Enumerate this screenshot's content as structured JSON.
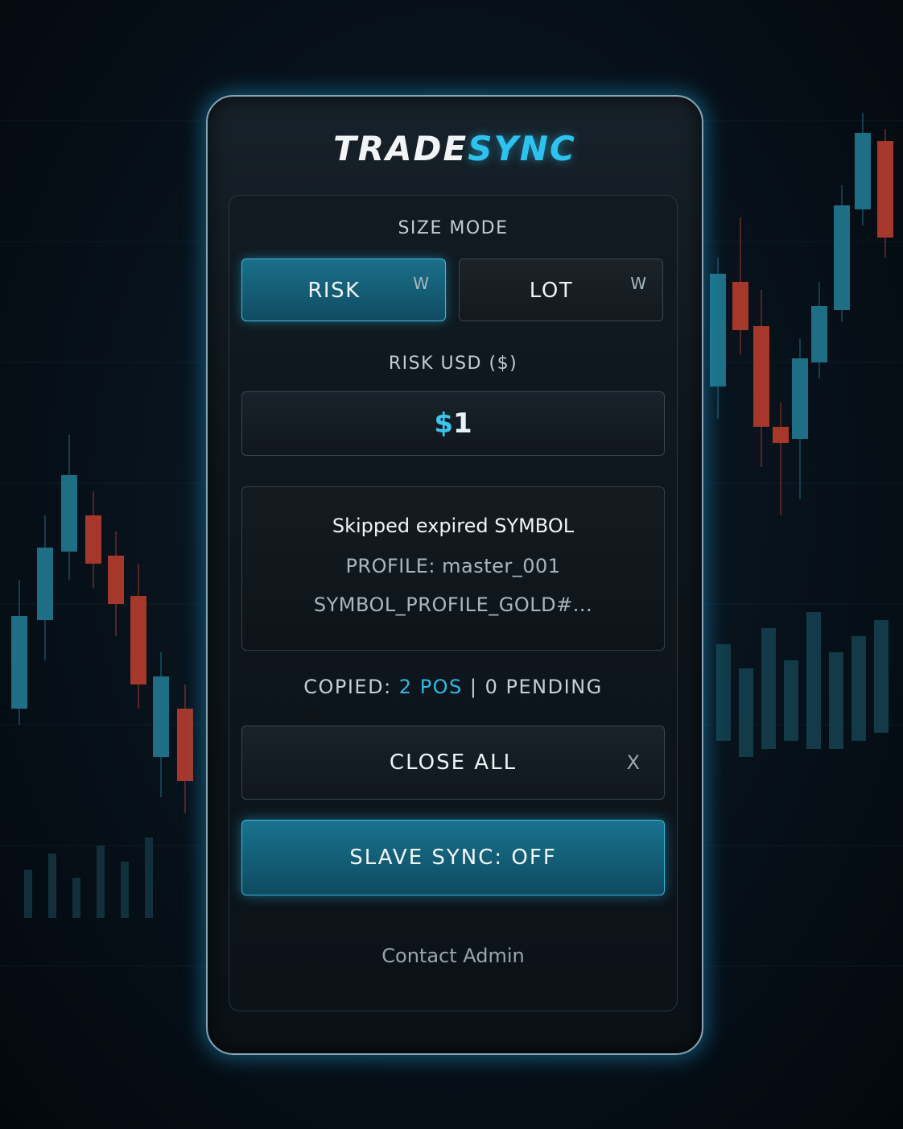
{
  "brand": {
    "part1": "TRADE",
    "part2": "SYNC"
  },
  "size_mode": {
    "label": "SIZE MODE",
    "options": [
      {
        "label": "RISK",
        "hint": "W",
        "active": true
      },
      {
        "label": "LOT",
        "hint": "W",
        "active": false
      }
    ]
  },
  "risk": {
    "label": "RISK USD ($)",
    "currency": "$",
    "value": "1"
  },
  "notice": {
    "line1": "Skipped expired SYMBOL",
    "line2": "PROFILE: master_001",
    "line3": "SYMBOL_PROFILE_GOLD#..."
  },
  "stats": {
    "prefix": "COPIED: ",
    "positions": "2 POS",
    "separator": " | ",
    "pending": "0 PENDING"
  },
  "actions": {
    "close_all": "CLOSE ALL",
    "close_icon": "X",
    "slave_sync": "SLAVE SYNC: OFF"
  },
  "footer": {
    "contact": "Contact Admin"
  },
  "colors": {
    "accent": "#2ec3ef",
    "bullish": "#1e6f86",
    "bearish": "#b2362a"
  }
}
